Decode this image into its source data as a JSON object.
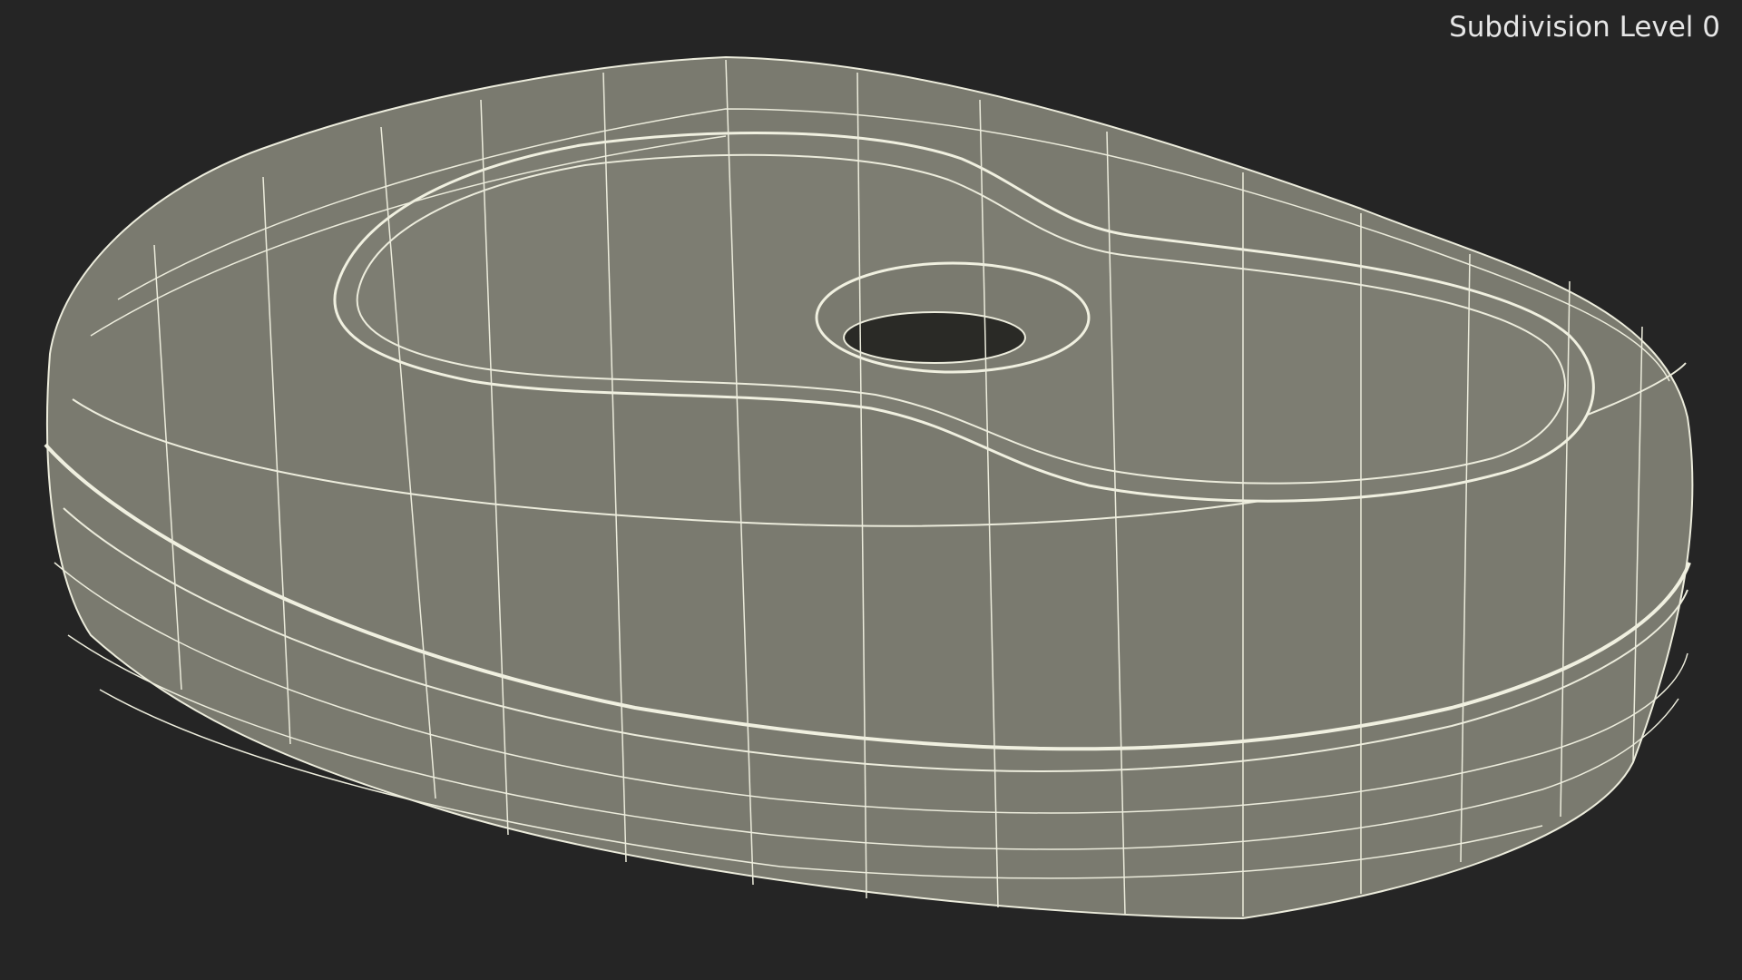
{
  "viewport": {
    "subdivision_label": "Subdivision Level 0",
    "background_color": "#252525"
  },
  "model": {
    "subject": "soap dish wireframe render",
    "surface_color": "#7a7a6f",
    "wire_color": "#ececdc"
  }
}
